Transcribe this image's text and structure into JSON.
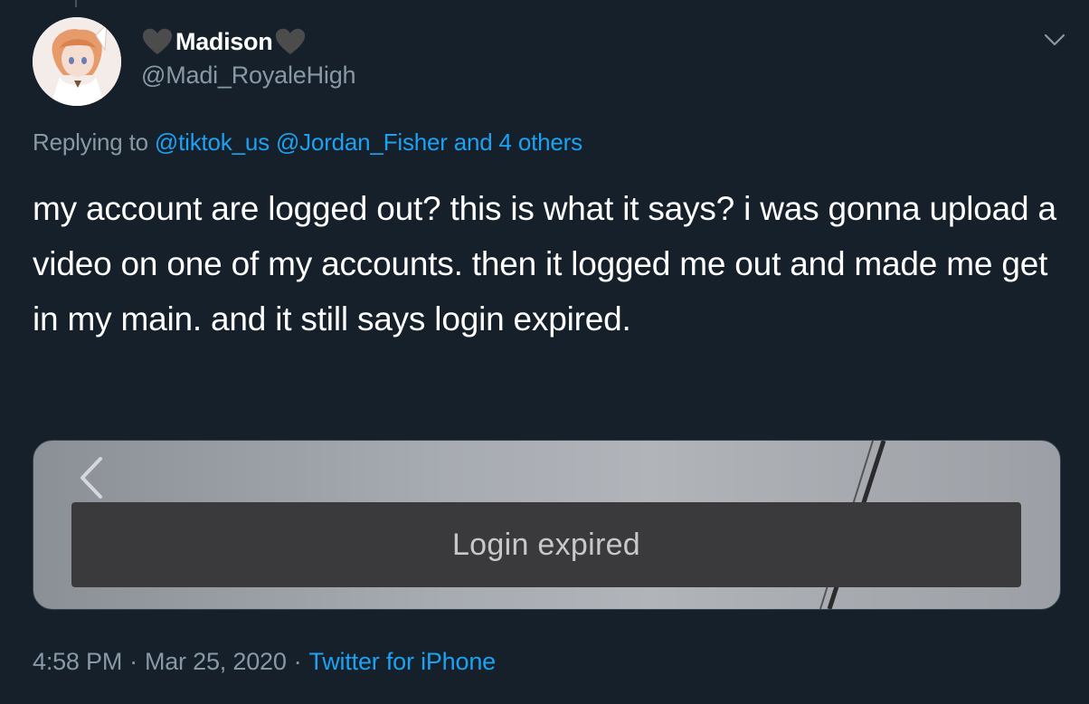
{
  "author": {
    "display_name": "Madison",
    "handle": "@Madi_RoyaleHigh"
  },
  "reply": {
    "prefix": "Replying to",
    "mentions": "@tiktok_us @Jordan_Fisher and 4 others"
  },
  "tweet": {
    "text": "my account are logged out? this is what it says? i was gonna upload a video on one of my accounts. then it logged me out and made me get in my main. and it still says login expired."
  },
  "media": {
    "toast_text": "Login expired"
  },
  "footer": {
    "time": "4:58 PM",
    "separator": "·",
    "date": "Mar 25, 2020",
    "source": "Twitter for iPhone"
  },
  "icons": {
    "heart_left": "black-heart-icon",
    "heart_right": "black-heart-icon",
    "caret": "chevron-down-icon",
    "media_back": "chevron-left-icon"
  },
  "colors": {
    "background": "#15202b",
    "link": "#1da1f2",
    "secondary_text": "#8899a6"
  }
}
